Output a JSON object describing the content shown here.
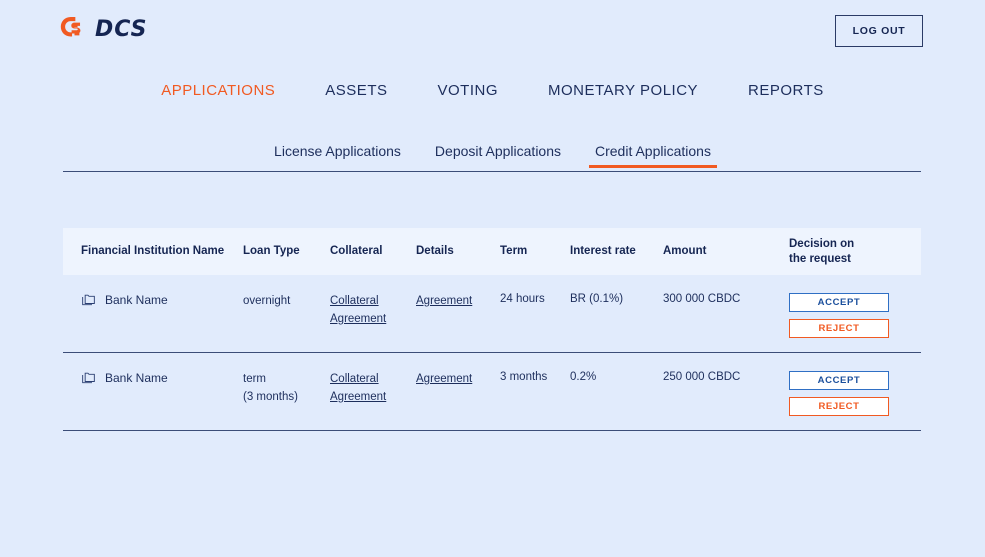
{
  "brand": {
    "name": "DCS",
    "logo_icon": "dcs-logo-icon",
    "accent": "#f15a22",
    "navy": "#152552"
  },
  "header": {
    "logout_label": "LOG OUT"
  },
  "main_nav": [
    {
      "label": "APPLICATIONS",
      "active": true
    },
    {
      "label": "ASSETS",
      "active": false
    },
    {
      "label": "VOTING",
      "active": false
    },
    {
      "label": "MONETARY POLICY",
      "active": false
    },
    {
      "label": "REPORTS",
      "active": false
    }
  ],
  "sub_tabs": [
    {
      "label": "License Applications",
      "active": false
    },
    {
      "label": "Deposit Applications",
      "active": false
    },
    {
      "label": "Credit Applications",
      "active": true
    }
  ],
  "table": {
    "columns": [
      "Financial Institution Name",
      "Loan Type",
      "Collateral",
      "Details",
      "Term",
      "Interest rate",
      "Amount",
      "Decision on\nthe request"
    ],
    "columns_decision_line1": "Decision on",
    "columns_decision_line2": "the request",
    "rows": [
      {
        "institution_icon": "folder-icon",
        "institution": "Bank Name",
        "loan_type_line1": "overnight",
        "loan_type_line2": "",
        "collateral_line1": "Collateral",
        "collateral_line2": "Agreement",
        "details": "Agreement",
        "term": "24 hours",
        "interest_rate": "BR (0.1%)",
        "amount": "300 000 CBDC",
        "accept_label": "ACCEPT",
        "reject_label": "REJECT"
      },
      {
        "institution_icon": "folder-icon",
        "institution": "Bank Name",
        "loan_type_line1": "term",
        "loan_type_line2": "(3 months)",
        "collateral_line1": "Collateral",
        "collateral_line2": "Agreement",
        "details": "Agreement",
        "term": "3 months",
        "interest_rate": "0.2%",
        "amount": "250 000 CBDC",
        "accept_label": "ACCEPT",
        "reject_label": "REJECT"
      }
    ]
  }
}
